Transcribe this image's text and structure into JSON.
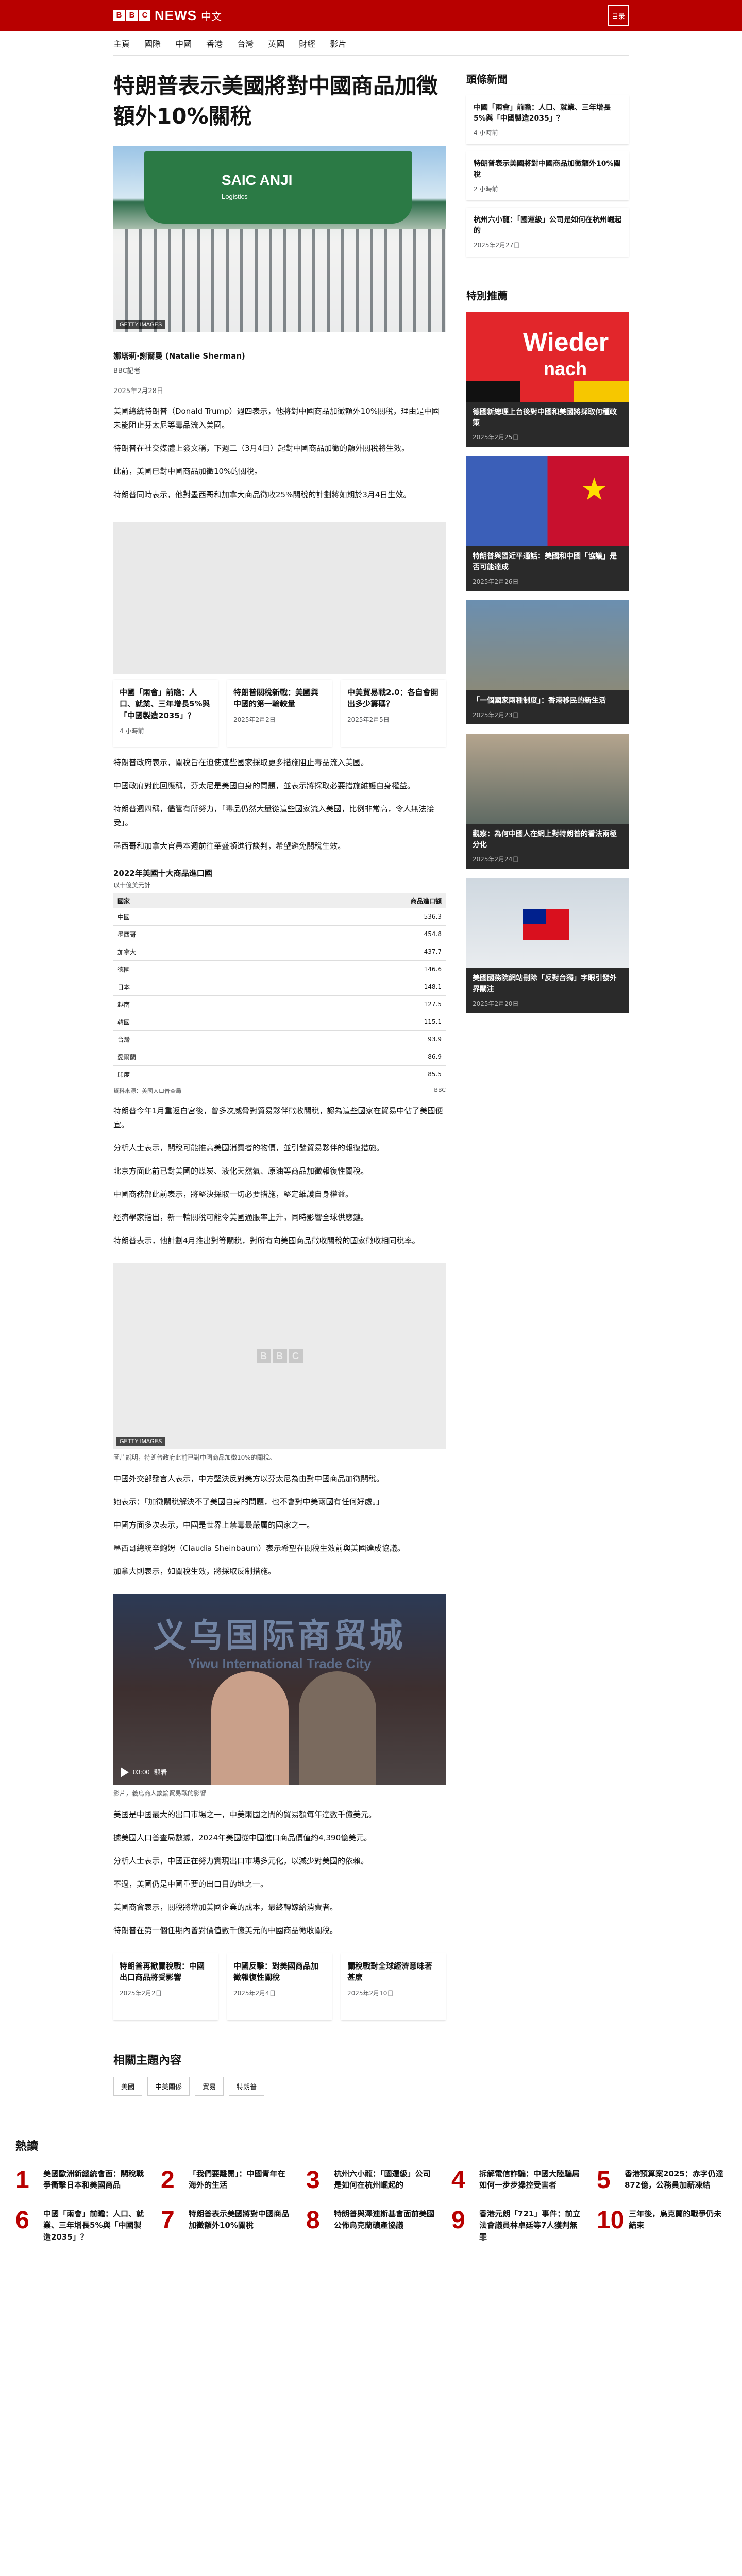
{
  "masthead": {
    "news": "NEWS",
    "sub": "中文",
    "bbc": [
      "B",
      "B",
      "C"
    ],
    "menu": "目录"
  },
  "nav": [
    "主頁",
    "國際",
    "中國",
    "香港",
    "台灣",
    "英國",
    "財經",
    "影片"
  ],
  "article": {
    "headline": "特朗普表示美國將對中國商品加徵額外10%關稅",
    "hero_credit": "GETTY IMAGES",
    "hero_ship": "SAIC ANJI",
    "hero_ship_sub": "Logistics",
    "author": "娜塔莉·謝爾曼 (Natalie Sherman)",
    "role": "BBC記者",
    "date": "2025年2月28日",
    "paragraphs_1": [
      "美國總統特朗普（Donald Trump）週四表示，他將對中國商品加徵額外10%關稅，理由是中國未能阻止芬太尼等毒品流入美國。",
      "特朗普在社交媒體上發文稱，下週二（3月4日）起對中國商品加徵的額外關稅將生效。",
      "此前，美國已對中國商品加徵10%的關稅。",
      "特朗普同時表示，他對墨西哥和加拿大商品徵收25%關稅的計劃將如期於3月4日生效。"
    ],
    "inline_cards": [
      {
        "title": "中國「兩會」前瞻：人口、就業、三年增長5%與「中國製造2035」？",
        "date": "4 小時前"
      },
      {
        "title": "特朗普關稅新戰：美國與中國的第一輪較量",
        "date": "2025年2月2日"
      },
      {
        "title": "中美貿易戰2.0：各自會開出多少籌碼？",
        "date": "2025年2月5日"
      }
    ],
    "paragraphs_2": [
      "特朗普政府表示，關稅旨在迫使這些國家採取更多措施阻止毒品流入美國。",
      "中國政府對此回應稱，芬太尼是美國自身的問題，並表示將採取必要措施維護自身權益。",
      "特朗普週四稱，儘管有所努力，「毒品仍然大量從這些國家流入美國，比例非常高，令人無法接受」。",
      "墨西哥和加拿大官員本週前往華盛頓進行談判，希望避免關稅生效。"
    ],
    "table": {
      "title": "2022年美國十大商品進口國",
      "subtitle": "以十億美元計",
      "headers": [
        "國家",
        "商品進口額"
      ],
      "rows": [
        [
          "中國",
          "536.3"
        ],
        [
          "墨西哥",
          "454.8"
        ],
        [
          "加拿大",
          "437.7"
        ],
        [
          "德國",
          "146.6"
        ],
        [
          "日本",
          "148.1"
        ],
        [
          "越南",
          "127.5"
        ],
        [
          "韓國",
          "115.1"
        ],
        [
          "台灣",
          "93.9"
        ],
        [
          "愛爾蘭",
          "86.9"
        ],
        [
          "印度",
          "85.5"
        ]
      ],
      "source": "資料來源：美國人口普查局",
      "badge": "BBC"
    },
    "paragraphs_3": [
      "特朗普今年1月重返白宮後，曾多次威脅對貿易夥伴徵收關稅，認為這些國家在貿易中佔了美國便宜。",
      "分析人士表示，關稅可能推高美國消費者的物價，並引發貿易夥伴的報復措施。",
      "北京方面此前已對美國的煤炭、液化天然氣、原油等商品加徵報復性關稅。",
      "中國商務部此前表示，將堅決採取一切必要措施，堅定維護自身權益。",
      "經濟學家指出，新一輪關稅可能令美國通脹率上升，同時影響全球供應鏈。",
      "特朗普表示，他計劃4月推出對等關稅，對所有向美國商品徵收關稅的國家徵收相同稅率。"
    ],
    "photo_credit": "GETTY IMAGES",
    "photo_caption": "圖片說明，特朗普政府此前已對中國商品加徵10%的關稅。",
    "paragraphs_4": [
      "中國外交部發言人表示，中方堅決反對美方以芬太尼為由對中國商品加徵關稅。",
      "她表示：「加徵關稅解決不了美國自身的問題，也不會對中美兩國有任何好處。」",
      "中國方面多次表示，中國是世界上禁毒最嚴厲的國家之一。",
      "墨西哥總統辛鮑姆（Claudia Sheinbaum）表示希望在關稅生效前與美國達成協議。",
      "加拿大則表示，如關稅生效，將採取反制措施。"
    ],
    "video_caption": "影片，義烏商人談論貿易戰的影響",
    "video_sign": "义乌国际商贸城",
    "video_sign_en": "Yiwu International Trade City",
    "video_time": "03:00",
    "video_label": "觀看",
    "paragraphs_5": [
      "美國是中國最大的出口市場之一，中美兩國之間的貿易額每年達數千億美元。",
      "據美國人口普查局數據，2024年美國從中國進口商品價值約4,390億美元。",
      "分析人士表示，中國正在努力實現出口市場多元化，以減少對美國的依賴。",
      "不過，美國仍是中國重要的出口目的地之一。",
      "美國商會表示，關稅將增加美國企業的成本，最終轉嫁給消費者。",
      "特朗普在第一個任期內曾對價值數千億美元的中國商品徵收關稅。"
    ],
    "bottom_cards": [
      {
        "title": "特朗普再掀關稅戰：中國出口商品將受影響",
        "date": "2025年2月2日"
      },
      {
        "title": "中國反擊：對美國商品加徵報復性關稅",
        "date": "2025年2月4日"
      },
      {
        "title": "關稅戰對全球經濟意味著甚麼",
        "date": "2025年2月10日"
      }
    ],
    "related_title": "相關主題內容",
    "tags": [
      "美國",
      "中美關係",
      "貿易",
      "特朗普"
    ]
  },
  "sidebar": {
    "top_title": "頭條新聞",
    "top_cards": [
      {
        "title": "中國「兩會」前瞻：人口、就業、三年增長5%與「中國製造2035」？",
        "date": "4 小時前"
      },
      {
        "title": "特朗普表示美國將對中國商品加徵額外10%關稅",
        "date": "2 小時前"
      },
      {
        "title": "杭州六小龍：「國運級」公司是如何在杭州崛起的",
        "date": "2025年2月27日"
      }
    ],
    "feature_title": "特別推薦",
    "features": [
      {
        "img": "wieder",
        "title": "德國新總理上台後對中國和美國將採取何種政策",
        "date": "2025年2月25日",
        "big": "Wieder",
        "mid": "nach"
      },
      {
        "img": "flags",
        "title": "特朗普與習近平通話：美國和中國「協議」是否可能達成",
        "date": "2025年2月26日"
      },
      {
        "img": "crowd",
        "title": "「一個國家兩種制度」：香港移民的新生活",
        "date": "2025年2月23日"
      },
      {
        "img": "street",
        "title": "觀察：為何中國人在網上對特朗普的看法兩極分化",
        "date": "2025年2月24日"
      },
      {
        "img": "taiwan",
        "title": "美國國務院網站刪除「反對台獨」字眼引發外界關注",
        "date": "2025年2月20日"
      }
    ]
  },
  "popular": {
    "title": "熱讀",
    "items": [
      {
        "num": "1",
        "title": "美國歐洲新總統會面：關稅戰爭衝擊日本和美國商品",
        "date": ""
      },
      {
        "num": "2",
        "title": "「我們要離開」：中國青年在海外的生活",
        "date": ""
      },
      {
        "num": "3",
        "title": "杭州六小龍：「國運級」公司是如何在杭州崛起的",
        "date": ""
      },
      {
        "num": "4",
        "title": "拆解電信詐騙：中國大陸騙局如何一步步操控受害者",
        "date": ""
      },
      {
        "num": "5",
        "title": "香港預算案2025：赤字仍達872億，公務員加薪凍結",
        "date": ""
      },
      {
        "num": "6",
        "title": "中國「兩會」前瞻：人口、就業、三年增長5%與「中國製造2035」？",
        "date": ""
      },
      {
        "num": "7",
        "title": "特朗普表示美國將對中國商品加徵額外10%關稅",
        "date": ""
      },
      {
        "num": "8",
        "title": "特朗普與澤連斯基會面前美國公佈烏克蘭礦產協議",
        "date": ""
      },
      {
        "num": "9",
        "title": "香港元朗「721」事件：前立法會議員林卓廷等7人獲判無罪",
        "date": ""
      },
      {
        "num": "10",
        "title": "三年後，烏克蘭的戰爭仍未結束",
        "date": ""
      }
    ]
  }
}
